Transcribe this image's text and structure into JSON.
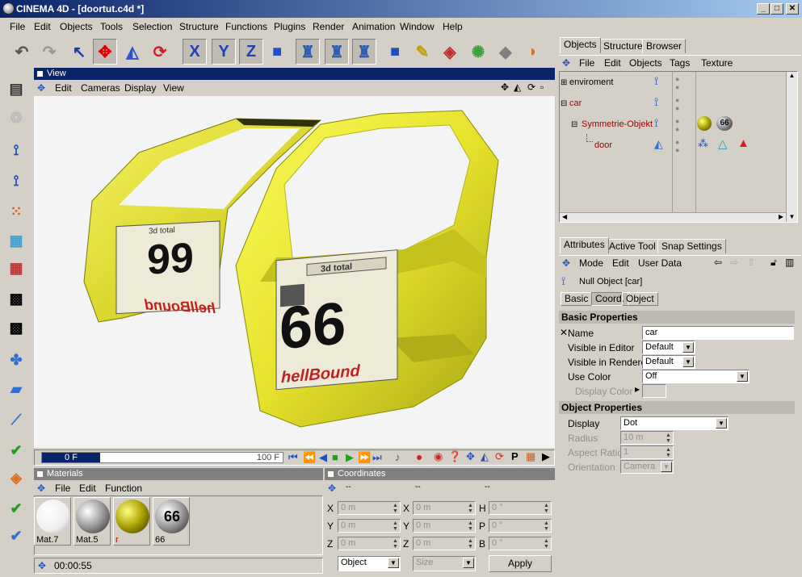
{
  "window": {
    "title": "CINEMA 4D - [doortut.c4d *]",
    "min": "_",
    "max": "□",
    "close": "✕"
  },
  "menu": [
    "File",
    "Edit",
    "Objects",
    "Tools",
    "Selection",
    "Structure",
    "Functions",
    "Plugins",
    "Render",
    "Animation",
    "Window",
    "Help"
  ],
  "toolbar": {
    "x_label": "X",
    "y_label": "Y",
    "z_label": "Z"
  },
  "view": {
    "title": "View",
    "menu": [
      "Edit",
      "Cameras",
      "Display",
      "View"
    ]
  },
  "timeline": {
    "start": "0 F",
    "end": "100 F"
  },
  "materials": {
    "title": "Materials",
    "menu": [
      "File",
      "Edit",
      "Function"
    ],
    "items": [
      {
        "name": "Mat.7",
        "color": "#ffffff"
      },
      {
        "name": "Mat.5",
        "color": "#c8c8c8"
      },
      {
        "name": "r",
        "color": "#c8c000"
      },
      {
        "name": "66",
        "color": "#e0e0e0"
      }
    ]
  },
  "coordinates": {
    "title": "Coordinates",
    "dashes": [
      "--",
      "--",
      "--"
    ],
    "rows": [
      {
        "a": "X",
        "av": "0 m",
        "b": "X",
        "bv": "0 m",
        "c": "H",
        "cv": "0 °"
      },
      {
        "a": "Y",
        "av": "0 m",
        "b": "Y",
        "bv": "0 m",
        "c": "P",
        "cv": "0 °"
      },
      {
        "a": "Z",
        "av": "0 m",
        "b": "Z",
        "bv": "0 m",
        "c": "B",
        "cv": "0 °"
      }
    ],
    "mode": "Object",
    "size": "Size",
    "apply": "Apply"
  },
  "status": {
    "time": "00:00:55"
  },
  "objects_panel": {
    "tabs": [
      "Objects",
      "Structure",
      "Browser"
    ],
    "menu": [
      "File",
      "Edit",
      "Objects",
      "Tags",
      "Texture"
    ],
    "tree": [
      {
        "name": "enviroment",
        "color": "#000000"
      },
      {
        "name": "car",
        "color": "#a00000"
      },
      {
        "name": "Symmetrie-Objekt",
        "color": "#a00000"
      },
      {
        "name": "door",
        "color": "#a00000"
      }
    ],
    "tag_label": "66"
  },
  "attributes": {
    "tabs": [
      "Attributes",
      "Active Tool",
      "Snap Settings"
    ],
    "menu": [
      "Mode",
      "Edit",
      "User Data"
    ],
    "object_title": "Null Object [car]",
    "subtabs": [
      "Basic",
      "Coord.",
      "Object"
    ],
    "basic_section": "Basic Properties",
    "name_label": "Name",
    "name_value": "car",
    "vis_editor_label": "Visible in Editor",
    "vis_editor_value": "Default",
    "vis_render_label": "Visible in Renderer",
    "vis_render_value": "Default",
    "use_color_label": "Use Color",
    "use_color_value": "Off",
    "display_color_label": "Display Color",
    "object_section": "Object Properties",
    "display_label": "Display",
    "display_value": "Dot",
    "radius_label": "Radius",
    "radius_value": "10 m",
    "aspect_label": "Aspect Ratio",
    "aspect_value": "1",
    "orientation_label": "Orientation",
    "orientation_value": "Camera"
  },
  "scene": {
    "door_number": "66",
    "door_number_mirror": "99",
    "brand": "hellBound",
    "brand_mirror": "hellBound",
    "plate": "3d total",
    "plate_mirror": "3d total"
  }
}
